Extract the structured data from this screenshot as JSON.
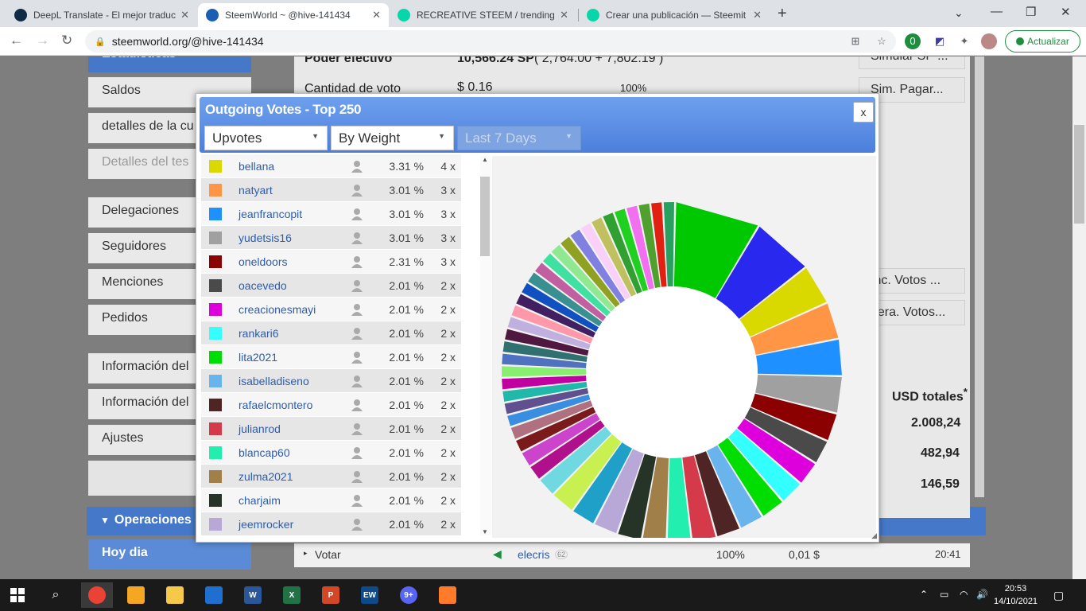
{
  "browser": {
    "tabs": [
      {
        "title": "DeepL Translate - El mejor traduc",
        "color": "#0f2b46"
      },
      {
        "title": "SteemWorld ~ @hive-141434",
        "color": "#1a5fb4"
      },
      {
        "title": "RECREATIVE STEEM / trending —",
        "color": "#06d6a9"
      },
      {
        "title": "Crear una publicación — Steemit",
        "color": "#06d6a9"
      }
    ],
    "url": "steemworld.org/@hive-141434",
    "update_label": "Actualizar",
    "ext_badge": "0"
  },
  "sidebar": {
    "section_top": "Estadísticas",
    "items": [
      {
        "label": "Saldos"
      },
      {
        "label": "detalles de la cu"
      },
      {
        "label": "Detalles del tes"
      },
      {
        "label": "Delegaciones"
      },
      {
        "label": "Seguidores"
      },
      {
        "label": "Menciones"
      },
      {
        "label": "Pedidos"
      },
      {
        "label": "Información del"
      },
      {
        "label": "Información del"
      },
      {
        "label": "Ajustes"
      }
    ],
    "operaciones": "Operaciones c",
    "hoy_dia": "Hoy dia"
  },
  "background": {
    "poder_label": "Poder efectivo",
    "poder_value": "10,566.24 SP",
    "poder_detail": "( 2,764.00 + 7,802.19 )",
    "voto_label": "Cantidad de voto",
    "voto_value": "$ 0.16",
    "voto_pct": "100%",
    "btn_simular": "Simular SP ...",
    "btn_sim_pagar": "Sim. Pagar...",
    "btn_inc_votos": "Inc. Votos ...",
    "btn_fuera_votos": "uera. Votos...",
    "usd_header": "USD totales",
    "usd_star": "*",
    "usd_values": [
      "2.008,24",
      "482,94",
      "146,59"
    ],
    "bottom_row": {
      "action": "Votar",
      "user": "elecris",
      "rep": "62",
      "pct": "100%",
      "value": "0,01 $",
      "time": "20:41"
    }
  },
  "modal": {
    "title": "Outgoing Votes - Top 250",
    "close": "x",
    "filter_type": "Upvotes",
    "filter_sort": "By Weight",
    "filter_period": "Last 7 Days",
    "rows": [
      {
        "name": "bellana",
        "pct": "3.31 %",
        "count": "4 x",
        "color": "#d9d900"
      },
      {
        "name": "natyart",
        "pct": "3.01 %",
        "count": "3 x",
        "color": "#ff9545"
      },
      {
        "name": "jeanfrancopit",
        "pct": "3.01 %",
        "count": "3 x",
        "color": "#1e90ff"
      },
      {
        "name": "yudetsis16",
        "pct": "3.01 %",
        "count": "3 x",
        "color": "#a0a0a0"
      },
      {
        "name": "oneldoors",
        "pct": "2.31 %",
        "count": "3 x",
        "color": "#8b0000"
      },
      {
        "name": "oacevedo",
        "pct": "2.01 %",
        "count": "2 x",
        "color": "#4a4a4a"
      },
      {
        "name": "creacionesmayi",
        "pct": "2.01 %",
        "count": "2 x",
        "color": "#dd00dd"
      },
      {
        "name": "rankari6",
        "pct": "2.01 %",
        "count": "2 x",
        "color": "#33ffff"
      },
      {
        "name": "lita2021",
        "pct": "2.01 %",
        "count": "2 x",
        "color": "#00dd00"
      },
      {
        "name": "isabelladiseno",
        "pct": "2.01 %",
        "count": "2 x",
        "color": "#6ab4ee"
      },
      {
        "name": "rafaelcmontero",
        "pct": "2.01 %",
        "count": "2 x",
        "color": "#4e2424"
      },
      {
        "name": "julianrod",
        "pct": "2.01 %",
        "count": "2 x",
        "color": "#d43a4a"
      },
      {
        "name": "blancap60",
        "pct": "2.01 %",
        "count": "2 x",
        "color": "#22eeb0"
      },
      {
        "name": "zulma2021",
        "pct": "2.01 %",
        "count": "2 x",
        "color": "#a07f48"
      },
      {
        "name": "charjaim",
        "pct": "2.01 %",
        "count": "2 x",
        "color": "#263428"
      },
      {
        "name": "jeemrocker",
        "pct": "2.01 %",
        "count": "2 x",
        "color": "#b8a8d8"
      }
    ]
  },
  "chart_data": {
    "type": "pie",
    "donut": true,
    "slices_named": [
      {
        "color": "#00c800",
        "value": 7.0
      },
      {
        "color": "#2828ee",
        "value": 5.0
      },
      {
        "color": "#d9d900",
        "value": 3.31
      },
      {
        "color": "#ff9545",
        "value": 3.01
      },
      {
        "color": "#1e90ff",
        "value": 3.01
      },
      {
        "color": "#a0a0a0",
        "value": 3.01
      },
      {
        "color": "#8b0000",
        "value": 2.31
      },
      {
        "color": "#4a4a4a",
        "value": 2.01
      },
      {
        "color": "#dd00dd",
        "value": 2.01
      },
      {
        "color": "#33ffff",
        "value": 2.01
      },
      {
        "color": "#00dd00",
        "value": 2.01
      },
      {
        "color": "#6ab4ee",
        "value": 2.01
      },
      {
        "color": "#4e2424",
        "value": 2.01
      },
      {
        "color": "#d43a4a",
        "value": 2.01
      },
      {
        "color": "#22eeb0",
        "value": 2.01
      },
      {
        "color": "#a07f48",
        "value": 2.01
      },
      {
        "color": "#263428",
        "value": 2.01
      },
      {
        "color": "#b8a8d8",
        "value": 2.01
      },
      {
        "color": "#1ea0c8",
        "value": 2.01
      },
      {
        "color": "#c8f050",
        "value": 2.01
      },
      {
        "color": "#70d8e0",
        "value": 1.6
      },
      {
        "color": "#b0108c",
        "value": 1.3
      },
      {
        "color": "#cc44cc",
        "value": 1.3
      },
      {
        "color": "#7a1a1a",
        "value": 1.1
      },
      {
        "color": "#b07080",
        "value": 1.1
      },
      {
        "color": "#3a8ee0",
        "value": 1.0
      },
      {
        "color": "#605090",
        "value": 1.0
      },
      {
        "color": "#20b8a8",
        "value": 1.0
      },
      {
        "color": "#c000a0",
        "value": 1.0
      },
      {
        "color": "#88ee70",
        "value": 1.0
      },
      {
        "color": "#5070c0",
        "value": 1.0
      },
      {
        "color": "#307070",
        "value": 1.0
      },
      {
        "color": "#501840",
        "value": 1.0
      },
      {
        "color": "#c0b0e0",
        "value": 1.0
      },
      {
        "color": "#ff99aa",
        "value": 1.0
      },
      {
        "color": "#402060",
        "value": 1.0
      },
      {
        "color": "#1050c0",
        "value": 1.0
      },
      {
        "color": "#3a9090",
        "value": 1.0
      },
      {
        "color": "#c060a0",
        "value": 1.0
      },
      {
        "color": "#40e0a0",
        "value": 1.0
      },
      {
        "color": "#90e890",
        "value": 1.0
      },
      {
        "color": "#90a020",
        "value": 1.0
      },
      {
        "color": "#8080e0",
        "value": 1.0
      },
      {
        "color": "#f8d0f8",
        "value": 1.0
      },
      {
        "color": "#c0c060",
        "value": 1.0
      },
      {
        "color": "#30a030",
        "value": 1.0
      },
      {
        "color": "#20d020",
        "value": 1.0
      },
      {
        "color": "#f070f0",
        "value": 1.0
      },
      {
        "color": "#50a030",
        "value": 1.0
      },
      {
        "color": "#e02010",
        "value": 1.0
      },
      {
        "color": "#28a060",
        "value": 1.0
      }
    ]
  },
  "taskbar": {
    "time": "20:53",
    "date": "14/10/2021",
    "apps": [
      {
        "name": "chrome",
        "color": "#ea4335",
        "label": ""
      },
      {
        "name": "vpn",
        "color": "#f5a623",
        "label": ""
      },
      {
        "name": "files",
        "color": "#f7c948",
        "label": ""
      },
      {
        "name": "security",
        "color": "#1f6fd1",
        "label": ""
      },
      {
        "name": "word",
        "color": "#2b579a",
        "label": "W"
      },
      {
        "name": "excel",
        "color": "#217346",
        "label": "X"
      },
      {
        "name": "powerpoint",
        "color": "#d24726",
        "label": "P"
      },
      {
        "name": "ew",
        "color": "#0c4a8c",
        "label": "EW"
      },
      {
        "name": "discord",
        "color": "#5865f2",
        "label": "9+"
      },
      {
        "name": "sublime",
        "color": "#ff7b2a",
        "label": ""
      }
    ]
  }
}
